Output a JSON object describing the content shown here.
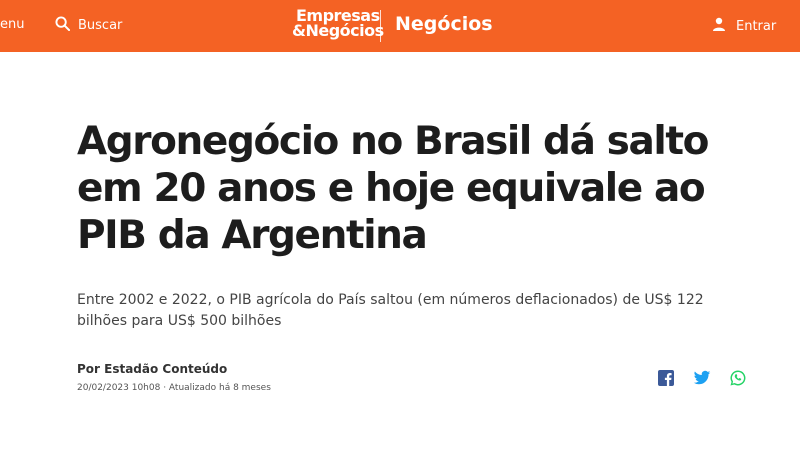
{
  "header": {
    "menu_label": "enu",
    "search_label": "Buscar",
    "logo_line1": "Empresas",
    "logo_line2": "&Negócios",
    "section": "Negócios",
    "login_label": "Entrar",
    "bar_color": "#f46224"
  },
  "article": {
    "headline": "Agronegócio no Brasil dá salto em 20 anos e hoje equivale ao PIB da Argentina",
    "subheadline": "Entre 2002 e 2022, o PIB agrícola do País saltou (em números deflacionados) de US$ 122 bilhões para US$ 500 bilhões",
    "byline": "Por Estadão Conteúdo",
    "dateline": "20/02/2023 10h08 · Atualizado há 8 meses"
  },
  "share": {
    "icons": [
      "facebook-icon",
      "twitter-icon",
      "whatsapp-icon"
    ],
    "facebook_color": "#3b5998",
    "twitter_color": "#1da1f2",
    "whatsapp_color": "#25d366"
  }
}
